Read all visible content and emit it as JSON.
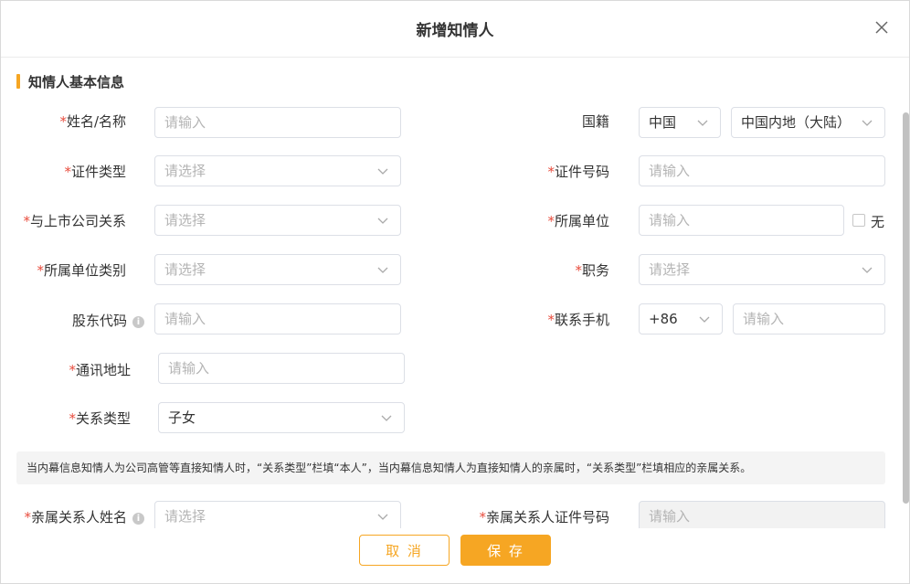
{
  "dialog": {
    "title": "新增知情人",
    "close_icon": "close-icon"
  },
  "section": {
    "title": "知情人基本信息",
    "accent": "#f6a623"
  },
  "form": {
    "name": {
      "label": "姓名/名称",
      "placeholder": "请输入"
    },
    "nationality": {
      "label": "国籍",
      "country": "中国",
      "region": "中国内地（大陆）"
    },
    "id_type": {
      "label": "证件类型",
      "placeholder": "请选择"
    },
    "id_number": {
      "label": "证件号码",
      "placeholder": "请输入"
    },
    "relation": {
      "label": "与上市公司关系",
      "placeholder": "请选择"
    },
    "employer": {
      "label": "所属单位",
      "placeholder": "请输入",
      "none_label": "无"
    },
    "employer_type": {
      "label": "所属单位类别",
      "placeholder": "请选择"
    },
    "position": {
      "label": "职务",
      "placeholder": "请选择"
    },
    "shareholder_code": {
      "label": "股东代码",
      "placeholder": "请输入"
    },
    "mobile": {
      "label": "联系手机",
      "code": "+86",
      "placeholder": "请输入"
    },
    "address": {
      "label": "通讯地址",
      "placeholder": "请输入"
    },
    "relation_type": {
      "label": "关系类型",
      "value": "子女"
    },
    "relative_name": {
      "label": "亲属关系人姓名",
      "placeholder": "请选择"
    },
    "relative_id": {
      "label": "亲属关系人证件号码",
      "placeholder": "请输入"
    }
  },
  "required_mark": "*",
  "info_icon_glyph": "i",
  "tip": "当内幕信息知情人为公司高管等直接知情人时，“关系类型”栏填“本人”，当内幕信息知情人为直接知情人的亲属时，“关系类型”栏填相应的亲属关系。",
  "buttons": {
    "cancel": "取 消",
    "save": "保 存"
  },
  "colors": {
    "required": "#e84c3d",
    "accent": "#f6a623",
    "placeholder": "#b4b4b4"
  }
}
